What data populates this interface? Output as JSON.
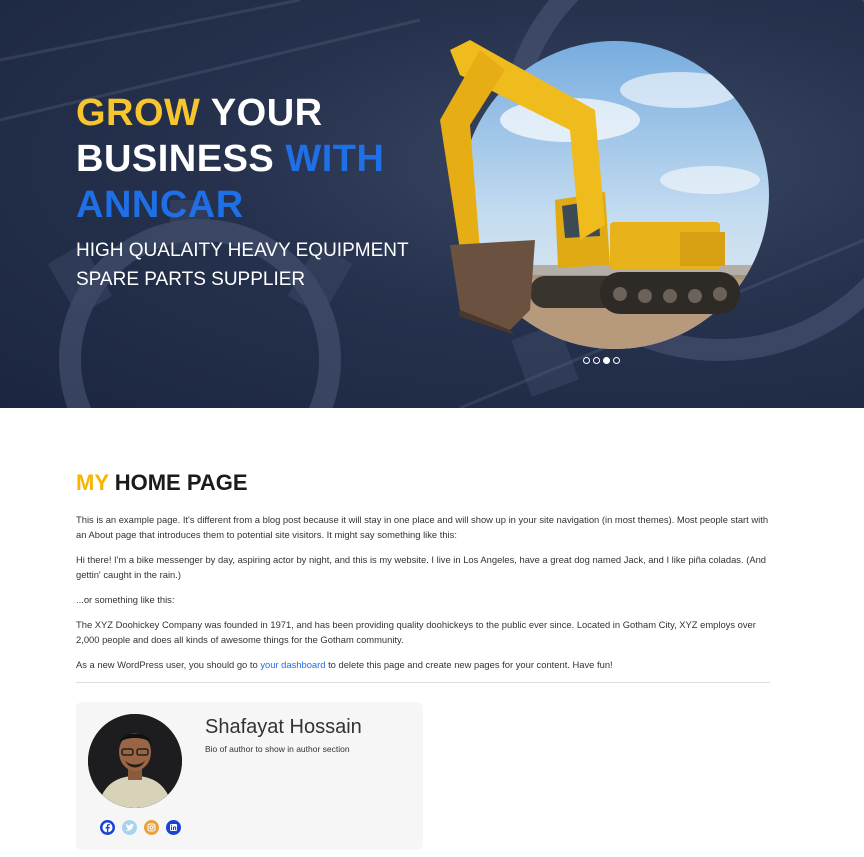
{
  "hero": {
    "title_line1_accent": "GROW",
    "title_line1_rest": " YOUR",
    "title_line2_start": "BUSINESS ",
    "title_line2_accent": "WITH",
    "title_line3_accent": "ANNCAR",
    "subtitle": "HIGH QUALAITY HEAVY EQUIPMENT SPARE PARTS SUPPLIER",
    "slides_count": 4,
    "active_slide": 3
  },
  "page": {
    "title_accent": "MY",
    "title_rest": " HOME PAGE",
    "paragraphs": [
      "This is an example page. It's different from a blog post because it will stay in one place and will show up in your site navigation (in most themes). Most people start with an About page that introduces them to potential site visitors. It might say something like this:",
      "Hi there! I'm a bike messenger by day, aspiring actor by night, and this is my website. I live in Los Angeles, have a great dog named Jack, and I like piña coladas. (And gettin' caught in the rain.)",
      "...or something like this:",
      "The XYZ Doohickey Company was founded in 1971, and has been providing quality doohickeys to the public ever since. Located in Gotham City, XYZ employs over 2,000 people and does all kinds of awesome things for the Gotham community."
    ],
    "last_before": "As a new WordPress user, you should go to ",
    "last_link": "your dashboard",
    "last_after": " to delete this page and create new pages for your content. Have fun!"
  },
  "author": {
    "name": "Shafayat Hossain",
    "bio": "Bio of author to show in author section",
    "socials": [
      "facebook-icon",
      "twitter-icon",
      "instagram-icon",
      "linkedin-icon"
    ]
  },
  "colors": {
    "accent_yellow": "#f7c52e",
    "accent_blue": "#1f6fe6",
    "hero_bg": "#26324d",
    "facebook": "#1a43d6",
    "twitter": "#a8d3f0",
    "instagram": "#e6a23c",
    "linkedin": "#1a43d6"
  }
}
